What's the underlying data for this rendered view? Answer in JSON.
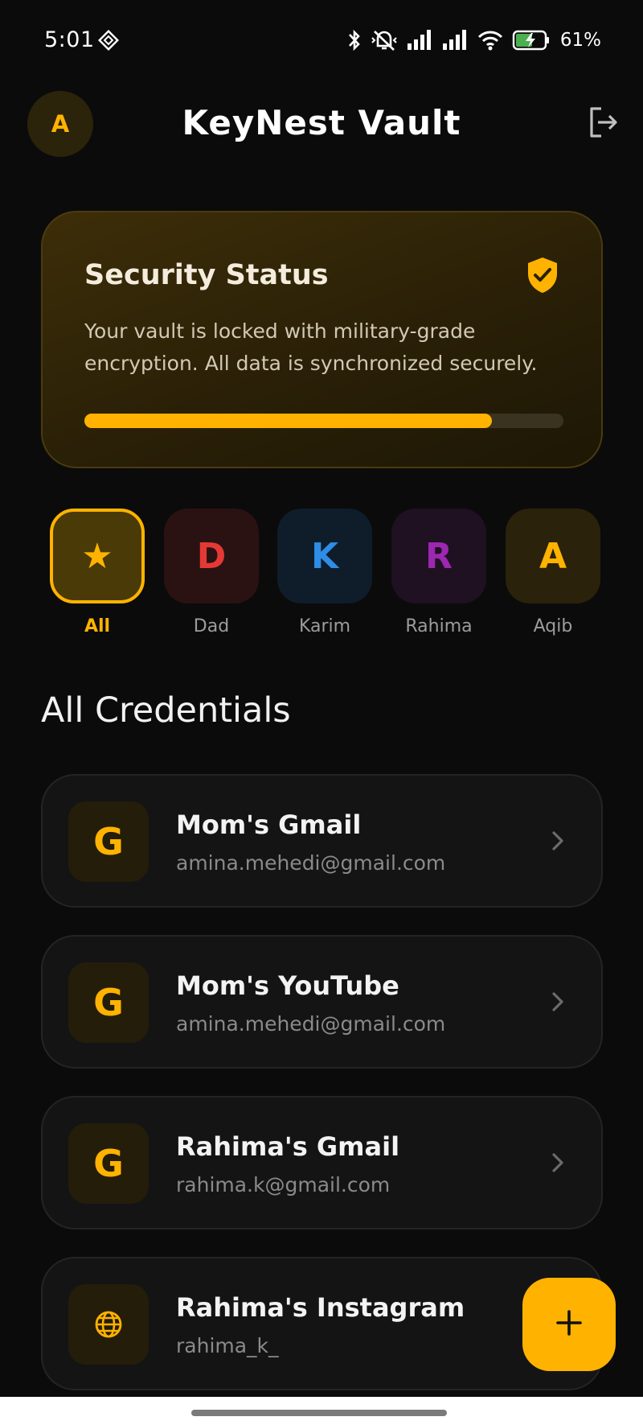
{
  "status_bar": {
    "time": "5:01",
    "battery_percent": "61%",
    "icons": [
      "nfc-icon",
      "bluetooth-icon",
      "vibrate-off-icon",
      "signal-icon",
      "signal-icon",
      "wifi-icon",
      "battery-charging-icon"
    ]
  },
  "header": {
    "avatar_letter": "A",
    "title": "KeyNest Vault",
    "logout_icon": "logout-icon"
  },
  "security": {
    "title": "Security Status",
    "description": "Your vault is locked with military-grade encryption. All data is synchronized securely.",
    "progress_fraction": 0.85,
    "icon": "shield-check-icon"
  },
  "chips": [
    {
      "glyph": "★",
      "label": "All",
      "active": true,
      "bg": "#4a3a08",
      "fg": "#ffb300"
    },
    {
      "glyph": "D",
      "label": "Dad",
      "active": false,
      "bg": "#2a1213",
      "fg": "#e53935"
    },
    {
      "glyph": "K",
      "label": "Karim",
      "active": false,
      "bg": "#0f1d2a",
      "fg": "#2e8de6"
    },
    {
      "glyph": "R",
      "label": "Rahima",
      "active": false,
      "bg": "#1f1022",
      "fg": "#9c27b0"
    },
    {
      "glyph": "A",
      "label": "Aqib",
      "active": false,
      "bg": "#2a220b",
      "fg": "#ffb300"
    }
  ],
  "section_title": "All Credentials",
  "credentials": [
    {
      "icon_letter": "G",
      "icon": "google-letter-icon",
      "name": "Mom's Gmail",
      "sub": "amina.mehedi@gmail.com"
    },
    {
      "icon_letter": "G",
      "icon": "google-letter-icon",
      "name": "Mom's YouTube",
      "sub": "amina.mehedi@gmail.com"
    },
    {
      "icon_letter": "G",
      "icon": "google-letter-icon",
      "name": "Rahima's Gmail",
      "sub": "rahima.k@gmail.com"
    },
    {
      "icon_letter": "",
      "icon": "globe-icon",
      "name": "Rahima's Instagram",
      "sub": "rahima_k_"
    }
  ],
  "fab": {
    "icon": "plus-icon"
  },
  "colors": {
    "accent": "#ffb300",
    "background": "#0b0b0b",
    "card": "#141414"
  }
}
